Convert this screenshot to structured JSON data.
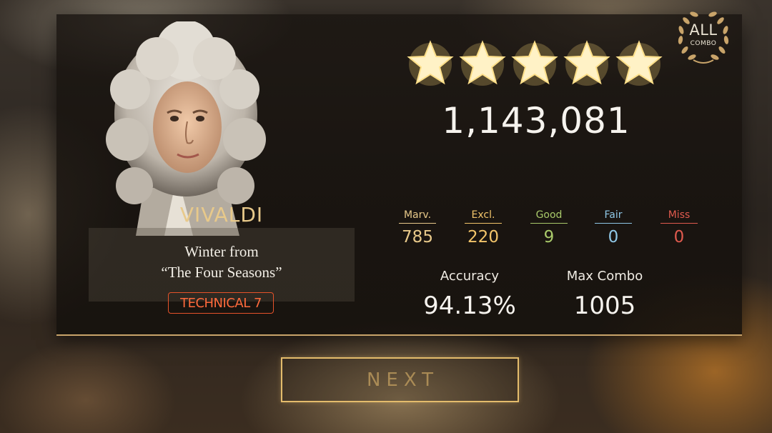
{
  "song": {
    "composer": "VIVALDI",
    "title_line1": "Winter from",
    "title_line2": "“The Four Seasons”",
    "difficulty": "TECHNICAL 7"
  },
  "result": {
    "stars": 5,
    "score": "1,143,081",
    "badge_main": "ALL",
    "badge_sub": "COMBO"
  },
  "judgements": [
    {
      "label": "Marv.",
      "value": "785",
      "color": "#e8c98a"
    },
    {
      "label": "Excl.",
      "value": "220",
      "color": "#f2c46a"
    },
    {
      "label": "Good",
      "value": "9",
      "color": "#a9c96a"
    },
    {
      "label": "Fair",
      "value": "0",
      "color": "#8fc7e6"
    },
    {
      "label": "Miss",
      "value": "0",
      "color": "#e05a4e"
    }
  ],
  "stats": {
    "accuracy_label": "Accuracy",
    "accuracy_value": "94.13%",
    "max_combo_label": "Max Combo",
    "max_combo_value": "1005"
  },
  "buttons": {
    "next_label": "NEXT"
  },
  "icons": {
    "star": "star-icon",
    "laurel": "laurel-wreath-icon",
    "portrait": "composer-portrait"
  }
}
